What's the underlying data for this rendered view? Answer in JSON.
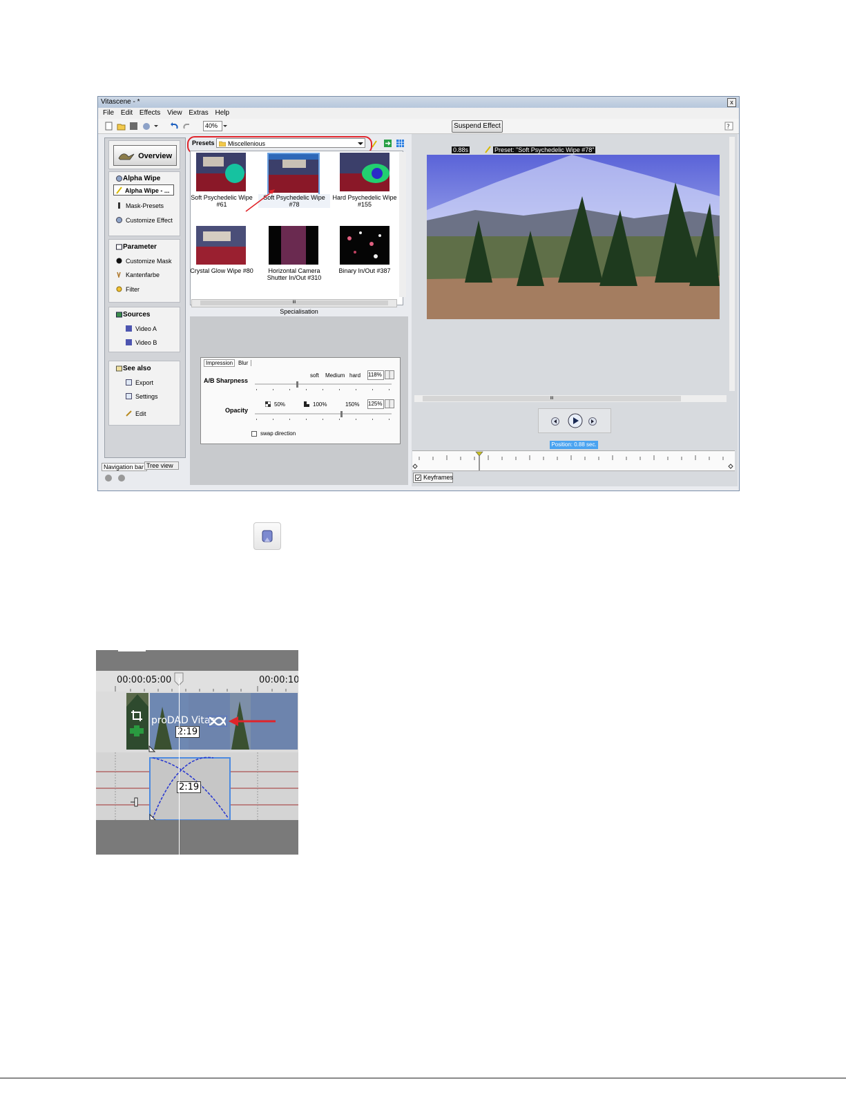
{
  "window": {
    "title": "Vitascene - *",
    "close_glyph": "x",
    "menu": [
      "File",
      "Edit",
      "Effects",
      "View",
      "Extras",
      "Help"
    ],
    "zoom": "40%",
    "suspend_label": "Suspend Effect"
  },
  "nav": {
    "overview_label": "Overview",
    "groups": [
      {
        "title": "Alpha Wipe",
        "button": "Alpha Wipe - ...",
        "items": [
          "Mask-Presets",
          "Customize Effect"
        ]
      },
      {
        "title": "Parameter",
        "items": [
          "Customize Mask",
          "Kantenfarbe",
          "Filter"
        ]
      },
      {
        "title": "Sources",
        "items": [
          "Video A",
          "Video B"
        ]
      },
      {
        "title": "See also",
        "items": [
          "Export",
          "Settings",
          "Edit"
        ]
      }
    ],
    "tabs": [
      "Navigation bar",
      "Tree view"
    ]
  },
  "presets": {
    "label": "Presets",
    "category": "Miscellenious",
    "items": [
      {
        "l1": "Soft Psychedelic Wipe",
        "l2": "#61"
      },
      {
        "l1": "Soft Psychedelic Wipe",
        "l2": "#78"
      },
      {
        "l1": "Hard Psychedelic Wipe",
        "l2": "#155"
      },
      {
        "l1": "Crystal Glow Wipe  #80",
        "l2": ""
      },
      {
        "l1": "Horizontal Camera",
        "l2": "Shutter In/Out #310"
      },
      {
        "l1": "Binary In/Out #387",
        "l2": ""
      }
    ],
    "scroll_grip": "III",
    "specialisation": "Specialisation"
  },
  "params": {
    "tabs": [
      "Impression",
      "Blur"
    ],
    "sharpness": {
      "label": "A/B Sharpness",
      "soft": "soft",
      "medium": "Medium",
      "hard": "hard",
      "value": "118%"
    },
    "opacity": {
      "label": "Opacity",
      "p50": "50%",
      "p100": "100%",
      "p150": "150%",
      "value": "125%"
    },
    "swap": "swap direction"
  },
  "preview": {
    "time": "0.88s",
    "preset_caption": "Preset: \"Soft Psychedelic Wipe  #78\"",
    "position": "Position: 0.88 sec.",
    "keyframes": "Keyframes",
    "scroll_grip": "III"
  },
  "timeline": {
    "tc1": "00:00:05:00",
    "tc2": "00:00:10:",
    "clip_label": "proDAD Vitas",
    "duration1": "2:19",
    "duration2": "2:19"
  },
  "colors": {
    "accent": "#e0242a",
    "position_bg": "#4aa3f0",
    "sky_top": "#5a63d8"
  }
}
